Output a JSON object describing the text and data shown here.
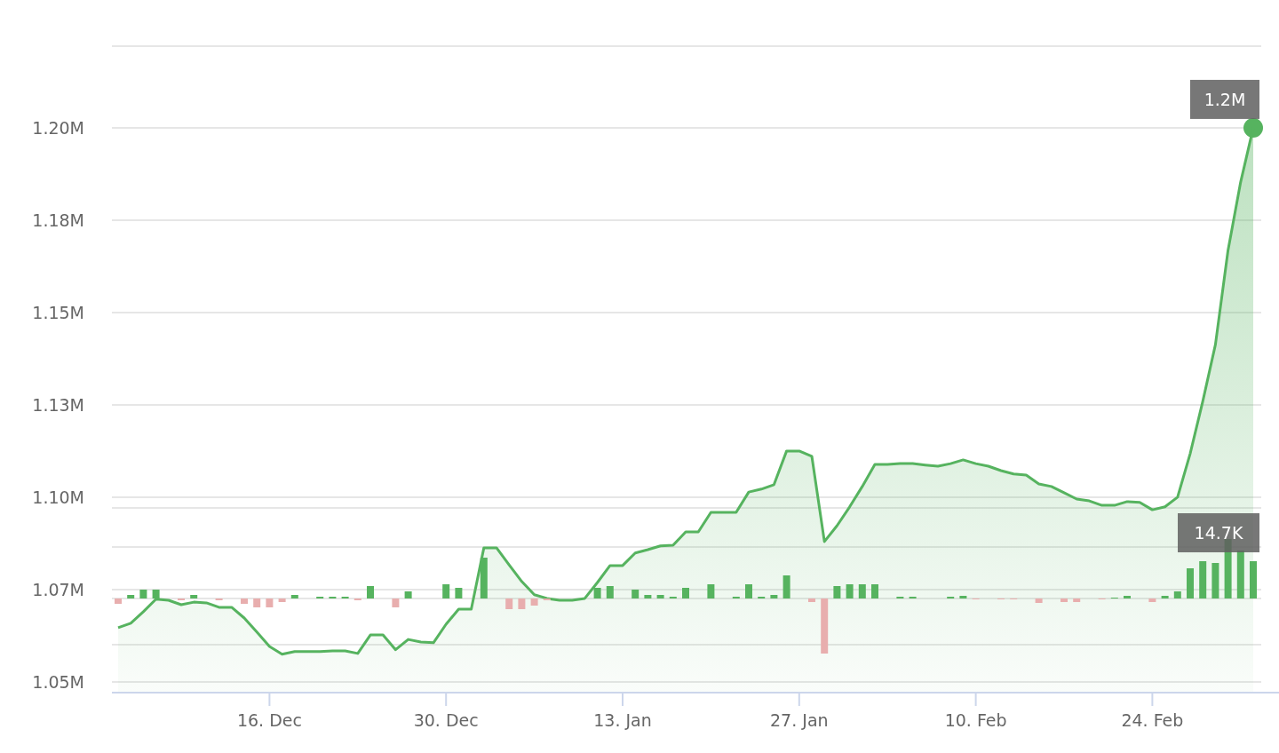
{
  "chart_data": {
    "type": "area",
    "categories": [
      null,
      null,
      null,
      null,
      null,
      null,
      null,
      null,
      null,
      null,
      null,
      null,
      "16. Dec",
      null,
      null,
      null,
      null,
      null,
      null,
      null,
      null,
      null,
      null,
      null,
      null,
      null,
      "30. Dec",
      null,
      null,
      null,
      null,
      null,
      null,
      null,
      null,
      null,
      null,
      null,
      null,
      null,
      "13. Jan",
      null,
      null,
      null,
      null,
      null,
      null,
      null,
      null,
      null,
      null,
      null,
      null,
      null,
      "27. Jan",
      null,
      null,
      null,
      null,
      null,
      null,
      null,
      null,
      null,
      null,
      null,
      null,
      null,
      "10. Feb",
      null,
      null,
      null,
      null,
      null,
      null,
      null,
      null,
      null,
      null,
      null,
      null,
      null,
      "24. Feb",
      null,
      null,
      null,
      null,
      null,
      null,
      null,
      null
    ],
    "ylim": [
      1.0471,
      1.2221
    ],
    "yticks": [
      {
        "value": 1.05,
        "label": "1.05M"
      },
      {
        "value": 1.075,
        "label": "1.07M"
      },
      {
        "value": 1.1,
        "label": "1.10M"
      },
      {
        "value": 1.125,
        "label": "1.13M"
      },
      {
        "value": 1.15,
        "label": "1.15M"
      },
      {
        "value": 1.175,
        "label": "1.18M"
      },
      {
        "value": 1.2,
        "label": "1.20M"
      }
    ],
    "series": [
      {
        "color": "#56b35f",
        "values": [
          1.0647,
          1.0659,
          1.069,
          1.0724,
          1.0721,
          1.0709,
          1.0716,
          1.0714,
          1.0702,
          1.0702,
          1.0673,
          1.0635,
          1.0596,
          1.0575,
          1.0582,
          1.0582,
          1.0582,
          1.0584,
          1.0584,
          1.0577,
          1.0627,
          1.0627,
          1.0587,
          1.0615,
          1.0608,
          1.0606,
          1.0656,
          1.0697,
          1.0697,
          1.0863,
          1.0863,
          1.0817,
          1.0772,
          1.0736,
          1.0726,
          1.0721,
          1.0721,
          1.0726,
          1.0769,
          1.0815,
          1.0815,
          1.0849,
          1.0858,
          1.0868,
          1.087,
          1.0906,
          1.0906,
          1.0959,
          1.0959,
          1.0959,
          1.1014,
          1.1022,
          1.1034,
          1.1125,
          1.1125,
          1.1111,
          1.088,
          1.0923,
          1.0974,
          1.1029,
          1.1089,
          1.1089,
          1.1091,
          1.1091,
          1.1087,
          1.1084,
          1.1091,
          1.1101,
          1.1091,
          1.1084,
          1.1072,
          1.1063,
          1.106,
          1.1036,
          1.1029,
          1.1012,
          1.0995,
          1.099,
          1.0978,
          1.0978,
          1.0988,
          1.0986,
          1.0966,
          1.0974,
          1.1,
          1.1118,
          1.126,
          1.1413,
          1.1668,
          1.1853,
          1.2
        ]
      }
    ],
    "grid": true
  },
  "last_value_label": "1.2M",
  "volume_label": "14.7K"
}
